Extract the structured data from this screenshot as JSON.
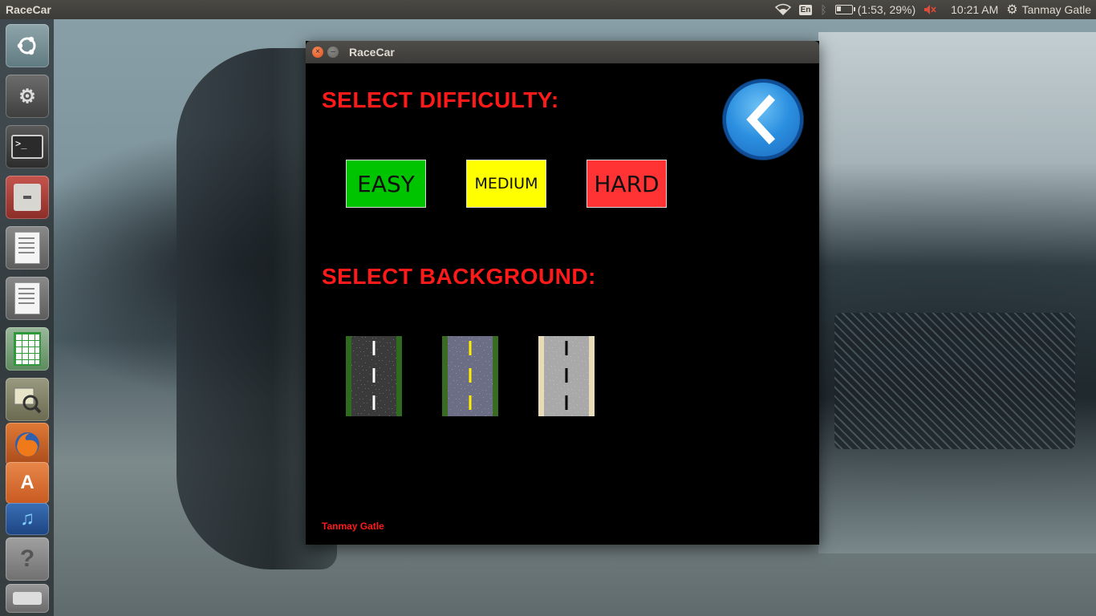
{
  "top_panel": {
    "app_title": "RaceCar",
    "keyboard_layout": "En",
    "battery_text": "(1:53, 29%)",
    "battery_percent": 29,
    "clock": "10:21 AM",
    "user_name": "Tanmay Gatle"
  },
  "launcher": {
    "items": [
      {
        "name": "ubuntu-dash"
      },
      {
        "name": "system-settings"
      },
      {
        "name": "terminal"
      },
      {
        "name": "file-cabinet"
      },
      {
        "name": "text-editor"
      },
      {
        "name": "text-editor-2"
      },
      {
        "name": "spreadsheet"
      },
      {
        "name": "image-viewer"
      },
      {
        "name": "firefox"
      },
      {
        "name": "software-center"
      },
      {
        "name": "music-player"
      },
      {
        "name": "help"
      },
      {
        "name": "removable-drive"
      }
    ]
  },
  "window": {
    "title": "RaceCar",
    "difficulty_heading": "SELECT DIFFICULTY:",
    "background_heading": "SELECT BACKGROUND:",
    "difficulty_buttons": [
      {
        "label": "EASY",
        "color": "#00c400"
      },
      {
        "label": "MEDIUM",
        "color": "#ffff00"
      },
      {
        "label": "HARD",
        "color": "#ff3333"
      }
    ],
    "backgrounds": [
      {
        "road": "#3a3a3a",
        "shoulder": "#2e6b1e",
        "line": "#ffffff"
      },
      {
        "road": "#6b6e85",
        "shoulder": "#3a6b22",
        "line": "#ffee00"
      },
      {
        "road": "#a9a9a9",
        "shoulder": "#e8dcb8",
        "line": "#000000"
      }
    ],
    "credit": "Tanmay Gatle",
    "accent_color": "#ff1a1a"
  }
}
